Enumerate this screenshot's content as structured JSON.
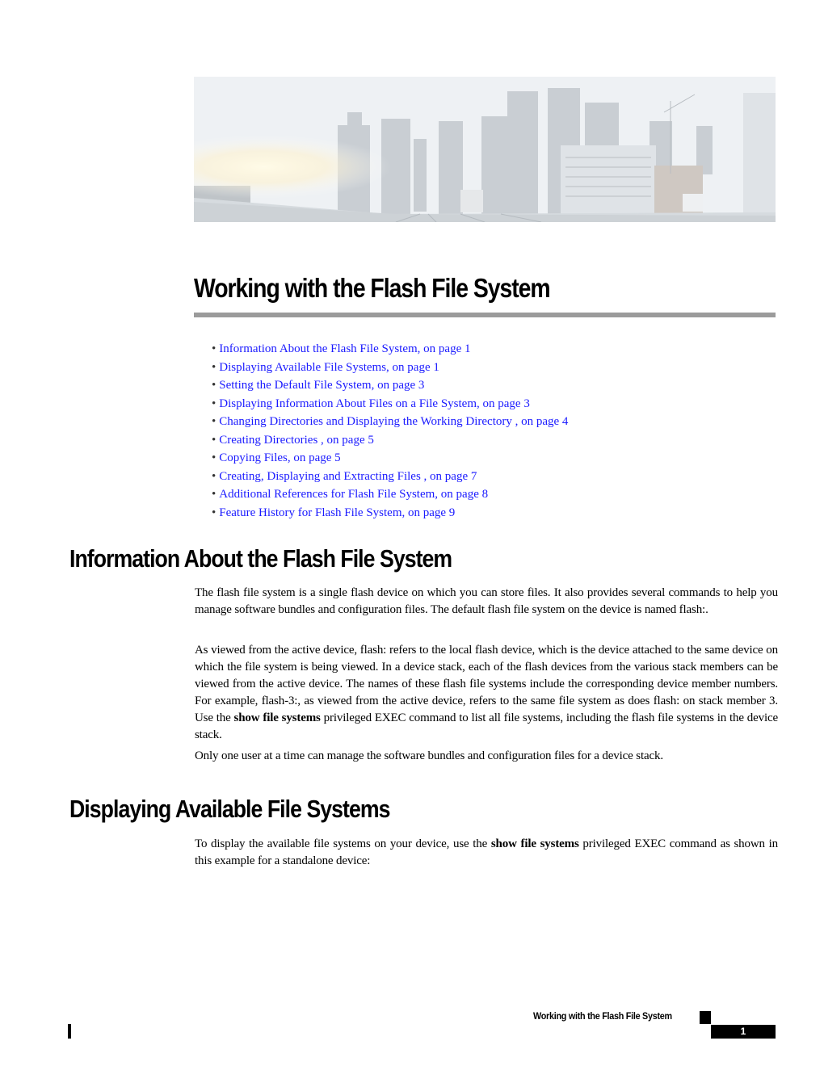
{
  "hero_image": {
    "description": "City skyline viewed from a bridge with sunlight"
  },
  "chapter": {
    "title": "Working with the Flash File System"
  },
  "toc": [
    {
      "label": "Information About the Flash File System, on page 1"
    },
    {
      "label": "Displaying Available File Systems, on page 1"
    },
    {
      "label": "Setting the Default File System, on page 3"
    },
    {
      "label": "Displaying Information About Files on a File System, on page 3"
    },
    {
      "label": "Changing Directories and Displaying the Working Directory , on page 4"
    },
    {
      "label": "Creating Directories , on page 5"
    },
    {
      "label": "Copying Files, on page 5"
    },
    {
      "label": "Creating, Displaying and Extracting Files , on page 7"
    },
    {
      "label": "Additional References for Flash File System, on page 8"
    },
    {
      "label": "Feature History for Flash File System, on page 9"
    }
  ],
  "toc_bullet": "•",
  "sections": [
    {
      "title": "Information About the Flash File System",
      "paragraphs": [
        {
          "text": "The flash file system is a single flash device on which you can store files. It also provides several commands to help you manage software bundles and configuration files. The default flash file system on the device is named flash:."
        },
        {
          "text_before": "As viewed from the active device, flash: refers to the local flash device, which is the device attached to the same device on which the file system is being viewed. In a device stack, each of the flash devices from the various stack members can be viewed from the active device. The names of these flash file systems include the corresponding device member numbers. For example, flash-3:, as viewed from the active device, refers to the same file system as does flash: on stack member 3. Use the ",
          "command": "show file systems",
          "text_after": " privileged EXEC command to list all file systems, including the flash file systems in the device stack."
        },
        {
          "text": "Only one user at a time can manage the software bundles and configuration files for a device stack."
        }
      ]
    },
    {
      "title": "Displaying Available File Systems",
      "paragraphs": [
        {
          "text_before": "To display the available file systems on your device, use the ",
          "command": "show file systems",
          "text_after": " privileged EXEC command as shown in this example for a standalone device:"
        }
      ]
    }
  ],
  "footer": {
    "title": "Working with the Flash File System",
    "page_number": "1"
  },
  "colors": {
    "link": "#1a1aff",
    "rule": "#9b9b9b"
  }
}
